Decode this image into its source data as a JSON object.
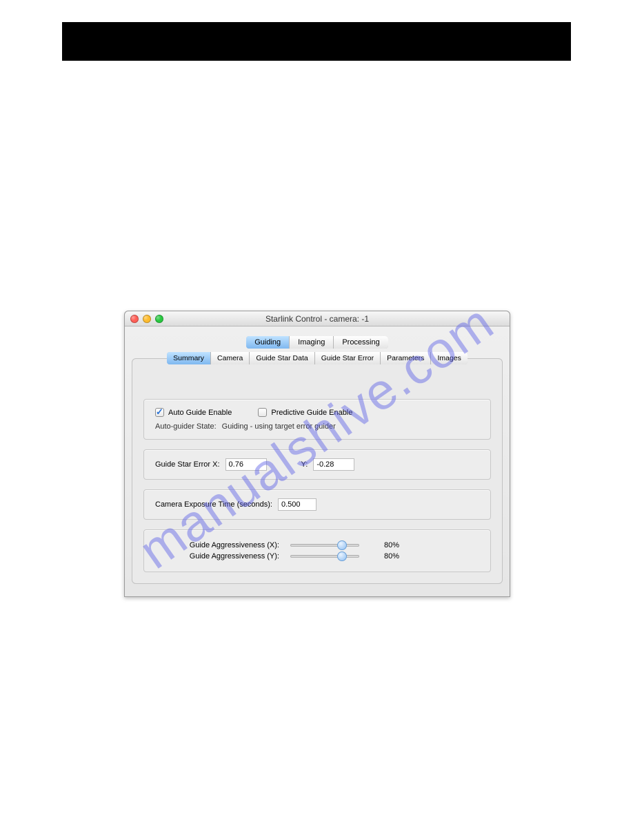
{
  "watermark": "manualshive.com",
  "window": {
    "title": "Starlink Control - camera: -1"
  },
  "main_tabs": [
    "Guiding",
    "Imaging",
    "Processing"
  ],
  "main_tab_selected": 0,
  "sub_tabs": [
    "Summary",
    "Camera",
    "Guide Star Data",
    "Guide Star Error",
    "Parameters",
    "Images"
  ],
  "sub_tab_selected": 0,
  "summary": {
    "auto_guide_label": "Auto Guide Enable",
    "auto_guide_checked": true,
    "predictive_guide_label": "Predictive Guide Enable",
    "predictive_guide_checked": false,
    "state_label": "Auto-guider State:",
    "state_value": "Guiding - using target error guider",
    "error_x_label": "Guide Star Error X:",
    "error_x_value": "0.76",
    "error_y_label": "Y:",
    "error_y_value": "-0.28",
    "exposure_label": "Camera Exposure Time (seconds):",
    "exposure_value": "0.500",
    "agg_x_label": "Guide Aggressiveness (X):",
    "agg_x_value": 80,
    "agg_x_display": "80%",
    "agg_y_label": "Guide Aggressiveness (Y):",
    "agg_y_value": 80,
    "agg_y_display": "80%"
  }
}
